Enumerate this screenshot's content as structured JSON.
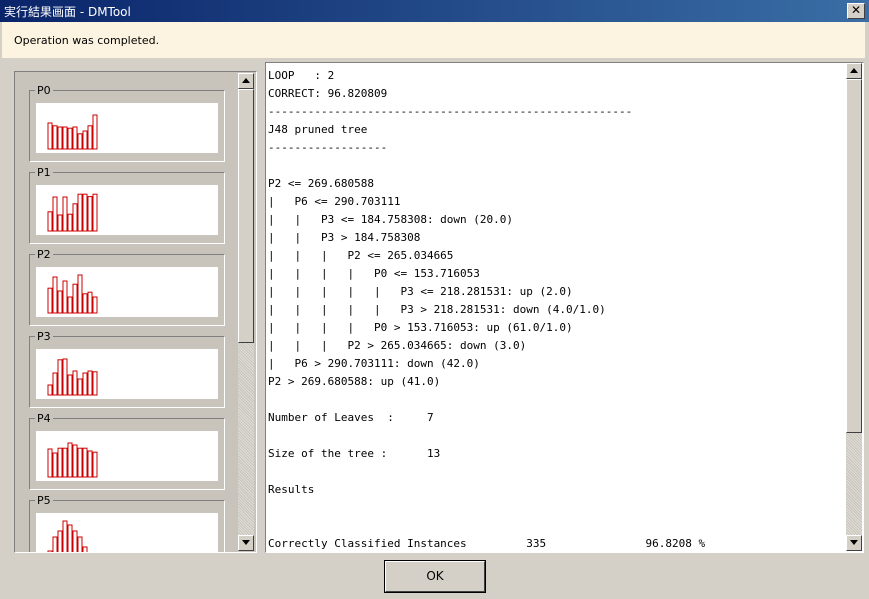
{
  "window": {
    "title": "実行結果画面 - DMTool",
    "close_glyph": "✕"
  },
  "status_message": "Operation was completed.",
  "bar_color": "#cc0000",
  "groups": [
    {
      "label": "P0",
      "values": [
        0.65,
        0.58,
        0.55,
        0.55,
        0.52,
        0.55,
        0.38,
        0.45,
        0.58,
        0.85
      ]
    },
    {
      "label": "P1",
      "values": [
        0.48,
        0.85,
        0.4,
        0.85,
        0.42,
        0.68,
        0.92,
        0.92,
        0.86,
        0.92
      ]
    },
    {
      "label": "P2",
      "values": [
        0.62,
        0.9,
        0.55,
        0.8,
        0.4,
        0.72,
        0.95,
        0.48,
        0.52,
        0.4
      ]
    },
    {
      "label": "P3",
      "values": [
        0.25,
        0.55,
        0.88,
        0.9,
        0.5,
        0.6,
        0.4,
        0.55,
        0.6,
        0.58
      ]
    },
    {
      "label": "P4",
      "values": [
        0.7,
        0.6,
        0.72,
        0.72,
        0.85,
        0.8,
        0.72,
        0.72,
        0.65,
        0.62
      ]
    },
    {
      "label": "P5",
      "values": [
        0.2,
        0.55,
        0.7,
        0.95,
        0.85,
        0.7,
        0.55,
        0.3,
        0.1,
        0.05
      ]
    }
  ],
  "result_lines": [
    "LOOP   : 2",
    "CORRECT: 96.820809",
    "-------------------------------------------------------",
    "J48 pruned tree",
    "------------------",
    "",
    "P2 <= 269.680588",
    "|   P6 <= 290.703111",
    "|   |   P3 <= 184.758308: down (20.0)",
    "|   |   P3 > 184.758308",
    "|   |   |   P2 <= 265.034665",
    "|   |   |   |   P0 <= 153.716053",
    "|   |   |   |   |   P3 <= 218.281531: up (2.0)",
    "|   |   |   |   |   P3 > 218.281531: down (4.0/1.0)",
    "|   |   |   |   P0 > 153.716053: up (61.0/1.0)",
    "|   |   |   P2 > 265.034665: down (3.0)",
    "|   P6 > 290.703111: down (42.0)",
    "P2 > 269.680588: up (41.0)",
    "",
    "Number of Leaves  :     7",
    "",
    "Size of the tree :      13",
    "",
    "Results",
    "",
    "",
    "Correctly Classified Instances         335               96.8208 %"
  ],
  "ok_label": "OK"
}
